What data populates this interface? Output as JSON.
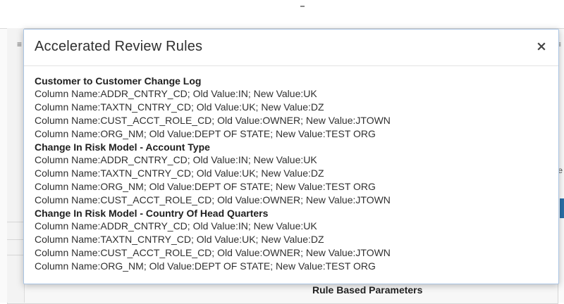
{
  "modal": {
    "title": "Accelerated Review Rules",
    "close_symbol": "×",
    "sections": [
      {
        "title": "Customer to Customer Change Log",
        "rows": [
          "Column Name:ADDR_CNTRY_CD; Old Value:IN; New Value:UK",
          "Column Name:TAXTN_CNTRY_CD; Old Value:UK; New Value:DZ",
          "Column Name:CUST_ACCT_ROLE_CD; Old Value:OWNER; New Value:JTOWN",
          "Column Name:ORG_NM; Old Value:DEPT OF STATE; New Value:TEST ORG"
        ]
      },
      {
        "title": "Change In Risk Model - Account Type",
        "rows": [
          "Column Name:ADDR_CNTRY_CD; Old Value:IN; New Value:UK",
          "Column Name:TAXTN_CNTRY_CD; Old Value:UK; New Value:DZ",
          "Column Name:ORG_NM; Old Value:DEPT OF STATE; New Value:TEST ORG",
          "Column Name:CUST_ACCT_ROLE_CD; Old Value:OWNER; New Value:JTOWN"
        ]
      },
      {
        "title": "Change In Risk Model - Country Of Head Quarters",
        "rows": [
          "Column Name:ADDR_CNTRY_CD; Old Value:IN; New Value:UK",
          "Column Name:TAXTN_CNTRY_CD; Old Value:UK; New Value:DZ",
          "Column Name:CUST_ACCT_ROLE_CD; Old Value:OWNER; New Value:JTOWN",
          "Column Name:ORG_NM; Old Value:DEPT OF STATE; New Value:TEST ORG"
        ]
      }
    ]
  },
  "background": {
    "section_heading": "Rule Based Parameters",
    "left_glyph": "≡",
    "right_glyph": "≡",
    "right_letter": "e"
  },
  "colors": {
    "modal_border": "#a9c4e3",
    "accent_strip": "#2b6fa6",
    "text": "#303030"
  }
}
